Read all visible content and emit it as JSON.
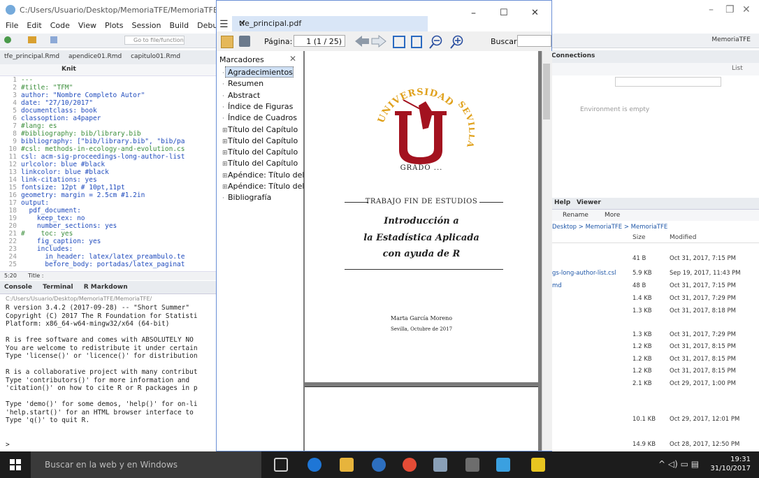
{
  "rstudio": {
    "title": "C:/Users/Usuario/Desktop/MemoriaTFE/MemoriaTFE - R",
    "menu": [
      "File",
      "Edit",
      "Code",
      "View",
      "Plots",
      "Session",
      "Build",
      "Debug"
    ],
    "goto_placeholder": "Go to file/function",
    "project": "MemoriaTFE",
    "editor_tabs": [
      "tfe_principal.Rmd",
      "apendice01.Rmd",
      "capitulo01.Rmd"
    ],
    "knit_label": "Knit",
    "status_pos": "5:20",
    "status_title": "Title :",
    "console_tabs": [
      "Console",
      "Terminal",
      "R Markdown"
    ],
    "console_path": "C:/Users/Usuario/Desktop/MemoriaTFE/MemoriaTFE/",
    "env_tab": "Connections",
    "env_empty": "Environment is empty",
    "env_list_label": "List",
    "files_tabs": [
      "Help",
      "Viewer"
    ],
    "files_rename": "Rename",
    "files_more": "More",
    "files_path": "Desktop > MemoriaTFE > MemoriaTFE",
    "files_col_size": "Size",
    "files_col_modified": "Modified"
  },
  "code_lines": [
    {
      "n": "1",
      "t": "---",
      "c": "green"
    },
    {
      "n": "2",
      "t": "#title: \"TFM\"",
      "c": "green"
    },
    {
      "n": "3",
      "t": "author: \"Nombre Completo Autor\"",
      "c": "blue"
    },
    {
      "n": "4",
      "t": "date: \"27/10/2017\"",
      "c": "blue"
    },
    {
      "n": "5",
      "t": "documentclass: book",
      "c": "blue"
    },
    {
      "n": "6",
      "t": "classoption: a4paper",
      "c": "blue"
    },
    {
      "n": "7",
      "t": "#lang: es",
      "c": "green"
    },
    {
      "n": "8",
      "t": "#bibliography: bib/library.bib",
      "c": "green"
    },
    {
      "n": "9",
      "t": "bibliography: [\"bib/library.bib\", \"bib/pa",
      "c": "blue"
    },
    {
      "n": "10",
      "t": "#csl: methods-in-ecology-and-evolution.cs",
      "c": "green"
    },
    {
      "n": "11",
      "t": "csl: acm-sig-proceedings-long-author-list",
      "c": "blue"
    },
    {
      "n": "12",
      "t": "urlcolor: blue #black",
      "c": "blue"
    },
    {
      "n": "13",
      "t": "linkcolor: blue #black",
      "c": "blue"
    },
    {
      "n": "14",
      "t": "link-citations: yes",
      "c": "blue"
    },
    {
      "n": "15",
      "t": "fontsize: 12pt # 10pt,11pt",
      "c": "blue"
    },
    {
      "n": "16",
      "t": "geometry: margin = 2.5cm #1.2in",
      "c": "blue"
    },
    {
      "n": "17",
      "t": "output:",
      "c": "blue"
    },
    {
      "n": "18",
      "t": "  pdf_document:",
      "c": "blue"
    },
    {
      "n": "19",
      "t": "    keep_tex: no",
      "c": "blue"
    },
    {
      "n": "20",
      "t": "    number_sections: yes",
      "c": "blue"
    },
    {
      "n": "21",
      "t": "#    toc: yes",
      "c": "green"
    },
    {
      "n": "22",
      "t": "    fig_caption: yes",
      "c": "blue"
    },
    {
      "n": "23",
      "t": "    includes:",
      "c": "blue"
    },
    {
      "n": "24",
      "t": "      in_header: latex/latex_preambulo.te",
      "c": "blue"
    },
    {
      "n": "25",
      "t": "      before_body: portadas/latex_paginat",
      "c": "blue"
    }
  ],
  "console_lines": [
    "R version 3.4.2 (2017-09-28) -- \"Short Summer\"",
    "Copyright (C) 2017 The R Foundation for Statisti",
    "Platform: x86_64-w64-mingw32/x64 (64-bit)",
    "",
    "R is free software and comes with ABSOLUTELY NO",
    "You are welcome to redistribute it under certain",
    "Type 'license()' or 'licence()' for distribution",
    "",
    "R is a collaborative project with many contribut",
    "Type 'contributors()' for more information and",
    "'citation()' on how to cite R or R packages in p",
    "",
    "Type 'demo()' for some demos, 'help()' for on-li",
    "'help.start()' for an HTML browser interface to",
    "Type 'q()' to quit R.",
    "",
    "",
    ">"
  ],
  "files": [
    {
      "name": "",
      "size": "41 B",
      "modified": "Oct 31, 2017, 7:15 PM"
    },
    {
      "name": "gs-long-author-list.csl",
      "size": "5.9 KB",
      "modified": "Sep 19, 2017, 11:43 PM"
    },
    {
      "name": "md",
      "size": "48 B",
      "modified": "Oct 31, 2017, 7:15 PM"
    },
    {
      "name": "",
      "size": "1.4 KB",
      "modified": "Oct 31, 2017, 7:29 PM"
    },
    {
      "name": "",
      "size": "1.3 KB",
      "modified": "Oct 31, 2017, 8:18 PM"
    },
    {
      "name": "",
      "size": "1.3 KB",
      "modified": "Oct 31, 2017, 7:29 PM"
    },
    {
      "name": "",
      "size": "1.2 KB",
      "modified": "Oct 31, 2017, 8:15 PM"
    },
    {
      "name": "",
      "size": "1.2 KB",
      "modified": "Oct 31, 2017, 8:15 PM"
    },
    {
      "name": "",
      "size": "1.2 KB",
      "modified": "Oct 31, 2017, 8:15 PM"
    },
    {
      "name": "",
      "size": "2.1 KB",
      "modified": "Oct 29, 2017, 1:00 PM"
    },
    {
      "name": "",
      "size": "10.1 KB",
      "modified": "Oct 29, 2017, 12:01 PM"
    },
    {
      "name": "",
      "size": "14.9 KB",
      "modified": "Oct 28, 2017, 12:50 PM"
    }
  ],
  "pdf": {
    "tab_title": "tfe_principal.pdf",
    "page_label": "Página:",
    "page_value": "1  (1 / 25)",
    "find_label": "Buscar:",
    "bookmarks_title": "Marcadores",
    "bookmarks": [
      {
        "label": "Agradecimientos",
        "expand": false
      },
      {
        "label": "Resumen",
        "expand": false
      },
      {
        "label": "Abstract",
        "expand": false
      },
      {
        "label": "Índice de Figuras",
        "expand": false
      },
      {
        "label": "Índice de Cuadros",
        "expand": false
      },
      {
        "label": "Título del Capítulo",
        "expand": true
      },
      {
        "label": "Título del Capítulo",
        "expand": true
      },
      {
        "label": "Título del Capítulo",
        "expand": true
      },
      {
        "label": "Título del Capítulo",
        "expand": true
      },
      {
        "label": "Apéndice: Título del",
        "expand": true
      },
      {
        "label": "Apéndice: Título del",
        "expand": true
      },
      {
        "label": "Bibliografía",
        "expand": false
      }
    ],
    "page": {
      "seal_text": "UNIVERSIDAD DE SEVILLA",
      "grado": "GRADO ...",
      "kind": "TRABAJO FIN DE ESTUDIOS",
      "title_l1": "Introducción a",
      "title_l2": "la Estadística Aplicada",
      "title_l3": "con ayuda de R",
      "author": "Marta García Moreno",
      "place_date": "Sevilla, Octubre de 2017"
    }
  },
  "taskbar": {
    "search_placeholder": "Buscar en la web y en Windows",
    "time": "19:31",
    "date": "31/10/2017"
  },
  "colors": {
    "seal_red": "#a3121f",
    "seal_gold": "#e0a11c",
    "accent_blue": "#6a8fd6"
  }
}
